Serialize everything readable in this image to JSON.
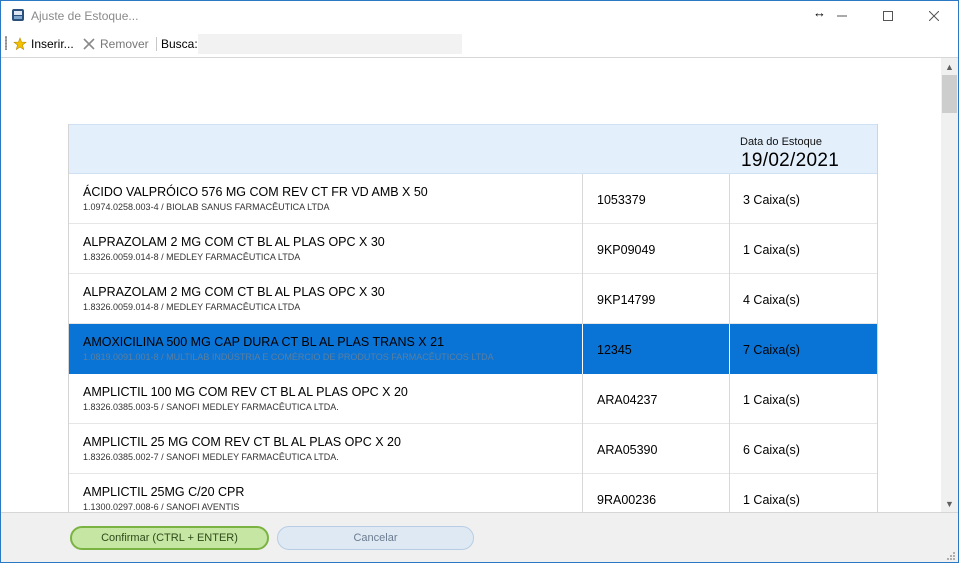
{
  "window": {
    "title": "Ajuste de Estoque..."
  },
  "toolbar": {
    "insert_label": "Inserir...",
    "remove_label": "Remover",
    "search_label": "Busca:",
    "search_value": ""
  },
  "header": {
    "date_label": "Data do Estoque",
    "date_value": "19/02/2021"
  },
  "rows": [
    {
      "name": "ÁCIDO VALPRÓICO 576 MG COM REV CT FR VD AMB X 50",
      "sub": "1.0974.0258.003-4 / BIOLAB SANUS FARMACÊUTICA LTDA",
      "lot": "1053379",
      "qty": "3 Caixa(s)"
    },
    {
      "name": "ALPRAZOLAM 2 MG COM CT BL AL PLAS OPC X 30",
      "sub": "1.8326.0059.014-8 / MEDLEY FARMACÊUTICA LTDA",
      "lot": "9KP09049",
      "qty": "1 Caixa(s)"
    },
    {
      "name": "ALPRAZOLAM 2 MG COM CT BL AL PLAS OPC X 30",
      "sub": "1.8326.0059.014-8 / MEDLEY FARMACÊUTICA LTDA",
      "lot": "9KP14799",
      "qty": "4 Caixa(s)"
    },
    {
      "name": "AMOXICILINA 500 MG CAP DURA CT BL AL PLAS TRANS X 21",
      "sub": "1.0819.0091.001-8 / MULTILAB INDÚSTRIA E COMÉRCIO DE PRODUTOS FARMACÊUTICOS LTDA",
      "lot": "12345",
      "qty": "7 Caixa(s)",
      "selected": true
    },
    {
      "name": "AMPLICTIL 100 MG COM REV CT BL AL PLAS OPC X 20",
      "sub": "1.8326.0385.003-5 / SANOFI MEDLEY FARMACÊUTICA LTDA.",
      "lot": "ARA04237",
      "qty": "1 Caixa(s)"
    },
    {
      "name": "AMPLICTIL 25 MG COM REV CT BL AL PLAS OPC X 20",
      "sub": "1.8326.0385.002-7 / SANOFI MEDLEY FARMACÊUTICA LTDA.",
      "lot": "ARA05390",
      "qty": "6 Caixa(s)"
    },
    {
      "name": "AMPLICTIL 25MG C/20 CPR",
      "sub": "1.1300.0297.008-6 / SANOFI AVENTIS",
      "lot": "9RA00236",
      "qty": "1 Caixa(s)"
    }
  ],
  "footer": {
    "confirm_label": "Confirmar (CTRL + ENTER)",
    "cancel_label": "Cancelar"
  },
  "colors": {
    "selected_row": "#0a73d6",
    "header_bg": "#e3f0fc",
    "confirm_bg": "#c6e6a3",
    "cancel_bg": "#dfe9f4"
  }
}
